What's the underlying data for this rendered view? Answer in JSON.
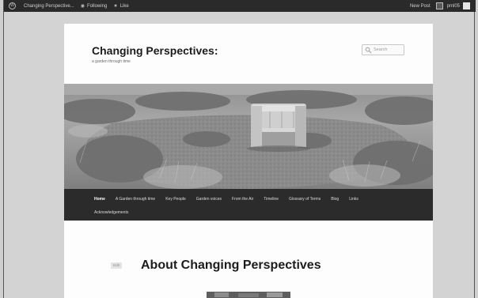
{
  "admin_bar": {
    "site_name": "Changing Perspective...",
    "following_label": "Following",
    "like_label": "Like",
    "new_post_label": "New Post",
    "user_label": "pml05"
  },
  "site": {
    "title": "Changing Perspectives:",
    "description": "a garden through time"
  },
  "search": {
    "placeholder": "Search"
  },
  "nav": {
    "items_row1": [
      {
        "label": "Home",
        "current": true
      },
      {
        "label": "A Garden through time"
      },
      {
        "label": "Key People"
      },
      {
        "label": "Garden voices"
      },
      {
        "label": "From the Air"
      },
      {
        "label": "Timeline"
      },
      {
        "label": "Glossary of Terms"
      },
      {
        "label": "Blog"
      },
      {
        "label": "Links"
      }
    ],
    "items_row2": [
      {
        "label": "Acknowledgements"
      }
    ]
  },
  "content": {
    "edit_label": "Edit",
    "entry_title": "About Changing Perspectives"
  },
  "colors": {
    "admin_bar_bg": "#2a2a2a",
    "nav_bg": "#2b2b2b",
    "page_bg": "#fdfdfd"
  }
}
